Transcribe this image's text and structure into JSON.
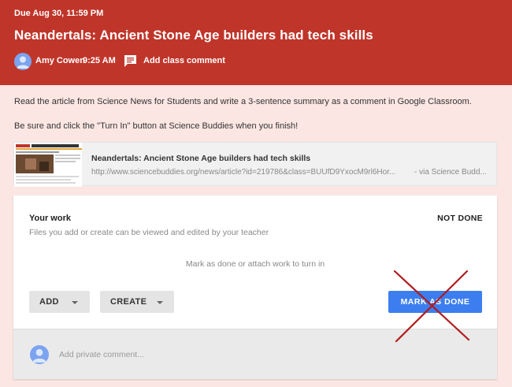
{
  "assignment": {
    "due": "Due Aug 30, 11:59 PM",
    "title": "Neandertals: Ancient Stone Age builders had tech skills",
    "author": "Amy Cowen",
    "time": "9:25 AM",
    "add_comment_label": "Add class comment"
  },
  "instructions": [
    "Read the article from Science News for Students and write a 3-sentence summary as a comment in Google Classroom.",
    "Be sure and click the \"Turn In\" button at Science Buddies when you finish!"
  ],
  "attachment": {
    "title": "Neandertals: Ancient Stone Age builders had tech skills",
    "url": "http://www.sciencebuddies.org/news/article?id=219786&class=BUUfD9YxocM9rl6Hor...",
    "source": "- via Science Budd..."
  },
  "work": {
    "heading": "Your work",
    "status": "NOT DONE",
    "files_note": "Files you add or create can be viewed and edited by your teacher",
    "mark_note": "Mark as done or attach work to turn in",
    "add_label": "ADD",
    "create_label": "CREATE",
    "mark_done_label": "MARK AS DONE",
    "private_placeholder": "Add private comment..."
  },
  "icons": {
    "avatar": "person-icon",
    "comment": "comment-icon",
    "caret": "caret-down-icon",
    "annotation": "red-x-mark"
  },
  "colors": {
    "header": "#c0352a",
    "background": "#fbe6e3",
    "primary_button": "#3c7ef0",
    "x_mark": "#b01c1c"
  }
}
